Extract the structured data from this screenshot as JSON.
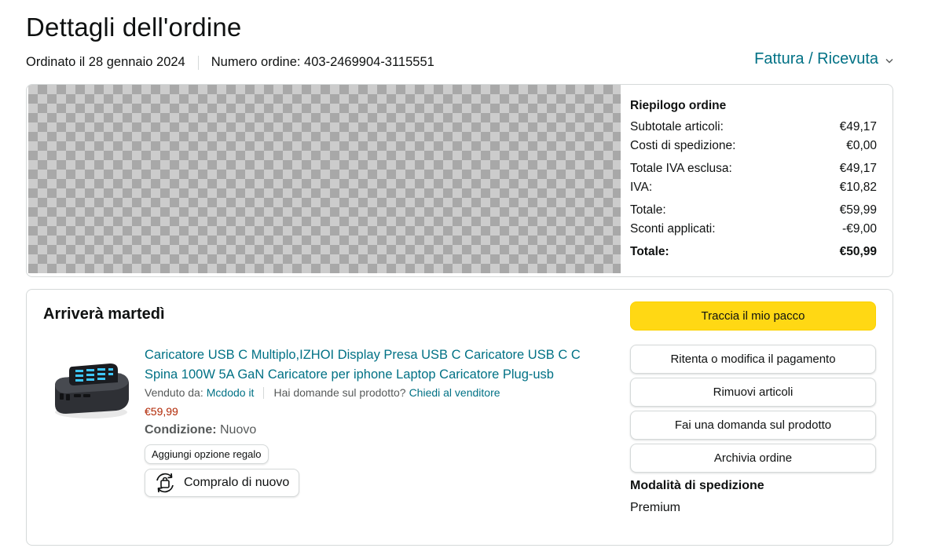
{
  "header": {
    "title": "Dettagli dell'ordine",
    "ordered_on": "Ordinato il 28 gennaio 2024",
    "order_number": "Numero ordine: 403-2469904-3115551",
    "invoice_link": "Fattura / Ricevuta"
  },
  "summary": {
    "title": "Riepilogo ordine",
    "rows": [
      {
        "label": "Subtotale articoli:",
        "value": "€49,17"
      },
      {
        "label": "Costi di spedizione:",
        "value": "€0,00"
      },
      {
        "label": "Totale IVA esclusa:",
        "value": "€49,17"
      },
      {
        "label": "IVA:",
        "value": "€10,82"
      },
      {
        "label": "Totale:",
        "value": "€59,99"
      },
      {
        "label": "Sconti applicati:",
        "value": "-€9,00"
      },
      {
        "label": "Totale:",
        "value": "€50,99"
      }
    ]
  },
  "shipment": {
    "arrival": "Arriverà martedì",
    "product": {
      "title": "Caricatore USB C Multiplo,IZHOI Display Presa USB C Caricatore USB C C Spina 100W 5A GaN Caricatore per iphone Laptop Caricatore Plug-usb",
      "sold_by_label": "Venduto da:",
      "seller": "Mcdodo it",
      "question_label": "Hai domande sul prodotto?",
      "ask_seller": "Chiedi al venditore",
      "price": "€59,99",
      "condition_label": "Condizione:",
      "condition_value": "Nuovo",
      "gift_button": "Aggiungi opzione regalo",
      "buy_again_button": "Compralo di nuovo"
    },
    "actions": {
      "track": "Traccia il mio pacco",
      "retry_payment": "Ritenta o modifica il pagamento",
      "remove_items": "Rimuovi articoli",
      "ask_question": "Fai una domanda sul prodotto",
      "archive": "Archivia ordine"
    },
    "shipping_mode_label": "Modalità di spedizione",
    "shipping_mode_value": "Premium"
  },
  "icons": {
    "invoice_chevron": "chevron-down-icon",
    "buy_again": "buy-again-icon"
  },
  "colors": {
    "link": "#007185",
    "price": "#b12704",
    "primary_button": "#ffd814",
    "border": "#d5d9d9"
  }
}
